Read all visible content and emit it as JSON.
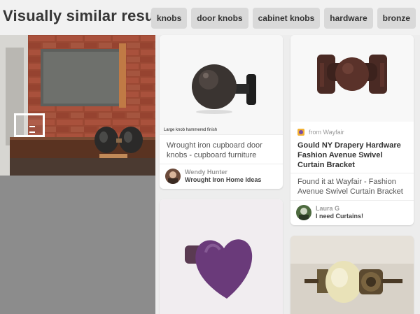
{
  "header": {
    "ghost_strip": "",
    "title": "Visually similar results",
    "chips": [
      "knobs",
      "door knobs",
      "cabinet knobs",
      "hardware",
      "bronze"
    ]
  },
  "pins": [
    {
      "image_caption": "Large knob hammered finish",
      "description": "Wrought iron cupboard door knobs - cupboard furniture",
      "pinner": {
        "name": "Wendy Hunter",
        "board": "Wrought Iron Home Ideas"
      }
    },
    {
      "source": "from Wayfair",
      "title": "Gould NY Drapery Hardware Fashion Avenue Swivel Curtain Bracket",
      "description": "Found it at Wayfair - Fashion Avenue Swivel Curtain Bracket",
      "pinner": {
        "name": "Laura G",
        "board": "I need Curtains!"
      }
    }
  ],
  "icons": [
    "selection-box-icon",
    "wayfair-icon",
    "avatar"
  ]
}
